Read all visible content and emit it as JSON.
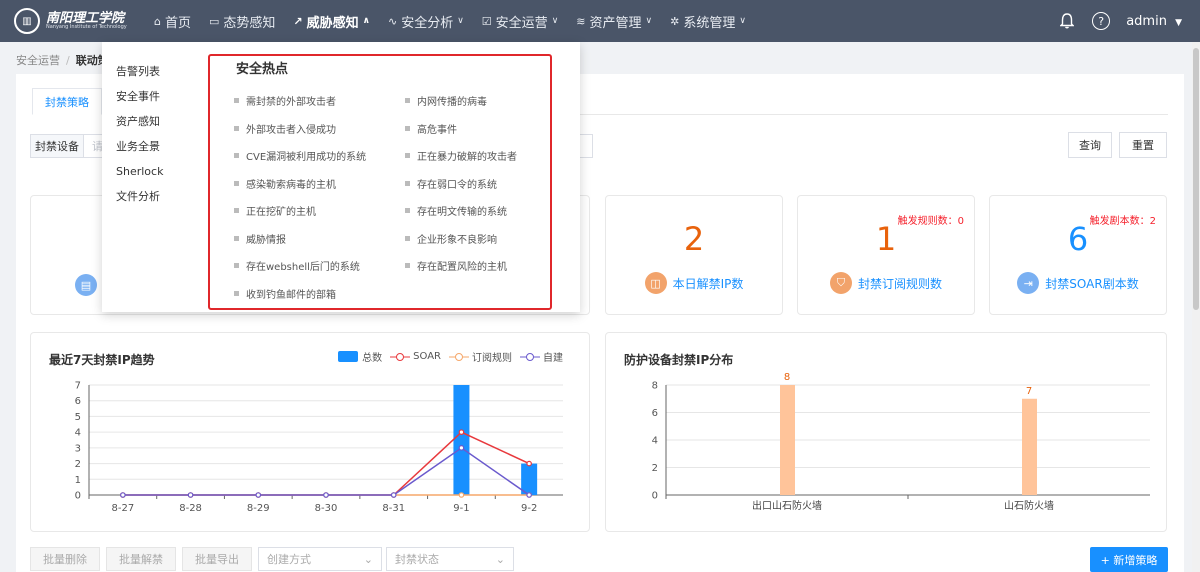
{
  "header": {
    "logo_cn": "南阳理工学院",
    "logo_en": "Nanyang Institute of Technology",
    "nav": [
      {
        "label": "首页",
        "icon": "home-icon",
        "active": false,
        "caret": false
      },
      {
        "label": "态势感知",
        "icon": "monitor-icon",
        "active": false,
        "caret": false
      },
      {
        "label": "威胁感知",
        "icon": "trend-icon",
        "active": true,
        "caret": true
      },
      {
        "label": "安全分析",
        "icon": "pulse-icon",
        "active": false,
        "caret": true
      },
      {
        "label": "安全运营",
        "icon": "check-square-icon",
        "active": false,
        "caret": true
      },
      {
        "label": "资产管理",
        "icon": "layers-icon",
        "active": false,
        "caret": true
      },
      {
        "label": "系统管理",
        "icon": "gear-icon",
        "active": false,
        "caret": true
      }
    ],
    "help_glyph": "?",
    "user": "admin"
  },
  "breadcrumb": {
    "parent": "安全运营",
    "sep": "/",
    "current": "联动策"
  },
  "tabs": {
    "active": "封禁策略"
  },
  "filter": {
    "label": "封禁设备",
    "placeholder": "请",
    "query_label": "查询",
    "reset_label": "重置"
  },
  "stats": [
    {
      "value": "2",
      "label": "本日解禁IP数",
      "warn": "",
      "color": "#e8620c"
    },
    {
      "value": "1",
      "label": "封禁订阅规则数",
      "warn": "触发规则数：0",
      "color": "#e8620c"
    },
    {
      "value": "6",
      "label": "封禁SOAR剧本数",
      "warn": "触发剧本数：2",
      "color": "#1890ff"
    }
  ],
  "trend_chart": {
    "title": "最近7天封禁IP趋势",
    "legend": [
      "总数",
      "SOAR",
      "订阅规则",
      "自建"
    ],
    "colors": {
      "total": "#1890ff",
      "soar": "#e8393d",
      "sub": "#f5a76a",
      "self": "#6a5acd"
    }
  },
  "device_chart": {
    "title": "防护设备封禁IP分布",
    "color": "#ffc49a",
    "label_color": "#e8620c"
  },
  "chart_data": [
    {
      "type": "bar",
      "title": "最近7天封禁IP趋势",
      "categories": [
        "8-27",
        "8-28",
        "8-29",
        "8-30",
        "8-31",
        "9-1",
        "9-2"
      ],
      "ylim": [
        0,
        7
      ],
      "yticks": [
        0,
        1,
        2,
        3,
        4,
        5,
        6,
        7
      ],
      "series": [
        {
          "name": "总数",
          "kind": "bar",
          "values": [
            0,
            0,
            0,
            0,
            0,
            7,
            2
          ]
        },
        {
          "name": "SOAR",
          "kind": "line",
          "values": [
            0,
            0,
            0,
            0,
            0,
            4,
            2
          ]
        },
        {
          "name": "订阅规则",
          "kind": "line",
          "values": [
            0,
            0,
            0,
            0,
            0,
            0,
            0
          ]
        },
        {
          "name": "自建",
          "kind": "line",
          "values": [
            0,
            0,
            0,
            0,
            0,
            3,
            0
          ]
        }
      ]
    },
    {
      "type": "bar",
      "title": "防护设备封禁IP分布",
      "categories": [
        "出口山石防火墙",
        "山石防火墙"
      ],
      "values": [
        8,
        7
      ],
      "ylim": [
        0,
        8
      ],
      "yticks": [
        0,
        2,
        4,
        6,
        8
      ]
    }
  ],
  "bottom": {
    "batch_delete": "批量删除",
    "batch_unblock": "批量解禁",
    "batch_export": "批量导出",
    "create_mode": "创建方式",
    "block_status": "封禁状态",
    "add_policy": "+ 新增策略"
  },
  "dropdown": {
    "left_items": [
      "告警列表",
      "安全事件",
      "资产感知",
      "业务全景",
      "Sherlock",
      "文件分析"
    ],
    "hot_title": "安全热点",
    "hot_col1": [
      "需封禁的外部攻击者",
      "外部攻击者入侵成功",
      "CVE漏洞被利用成功的系统",
      "感染勒索病毒的主机",
      "正在挖矿的主机",
      "威胁情报",
      "存在webshell后门的系统",
      "收到钓鱼邮件的部箱"
    ],
    "hot_col2": [
      "内网传播的病毒",
      "高危事件",
      "正在暴力破解的攻击者",
      "存在弱口令的系统",
      "存在明文传输的系统",
      "企业形象不良影响",
      "存在配置风险的主机"
    ]
  }
}
